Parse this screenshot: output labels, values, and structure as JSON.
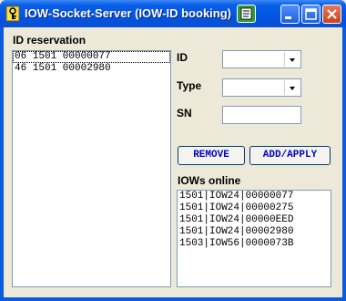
{
  "window": {
    "title": "IOW-Socket-Server  (IOW-ID booking)",
    "icons": {
      "app": "key-icon",
      "tray": "notepad-icon"
    },
    "controls": {
      "minimize": "minimize-icon",
      "maximize": "maximize-icon",
      "close": "close-icon"
    }
  },
  "reservation": {
    "label": "ID reservation",
    "items": [
      "06 1501 00000077",
      "46 1501 00002980"
    ]
  },
  "form": {
    "id_label": "ID",
    "id_value": "",
    "type_label": "Type",
    "type_value": "",
    "sn_label": "SN",
    "sn_value": ""
  },
  "buttons": {
    "remove": "REMOVE",
    "add_apply": "ADD/APPLY"
  },
  "online": {
    "label": "IOWs online",
    "items": [
      "1501|IOW24|00000077",
      "1501|IOW24|00000275",
      "1501|IOW24|00000EED",
      "1501|IOW24|00002980",
      "1503|IOW56|0000073B"
    ]
  },
  "colors": {
    "titlebar": "#0055e5",
    "button_text": "#0000cc",
    "face": "#ece9d8"
  }
}
